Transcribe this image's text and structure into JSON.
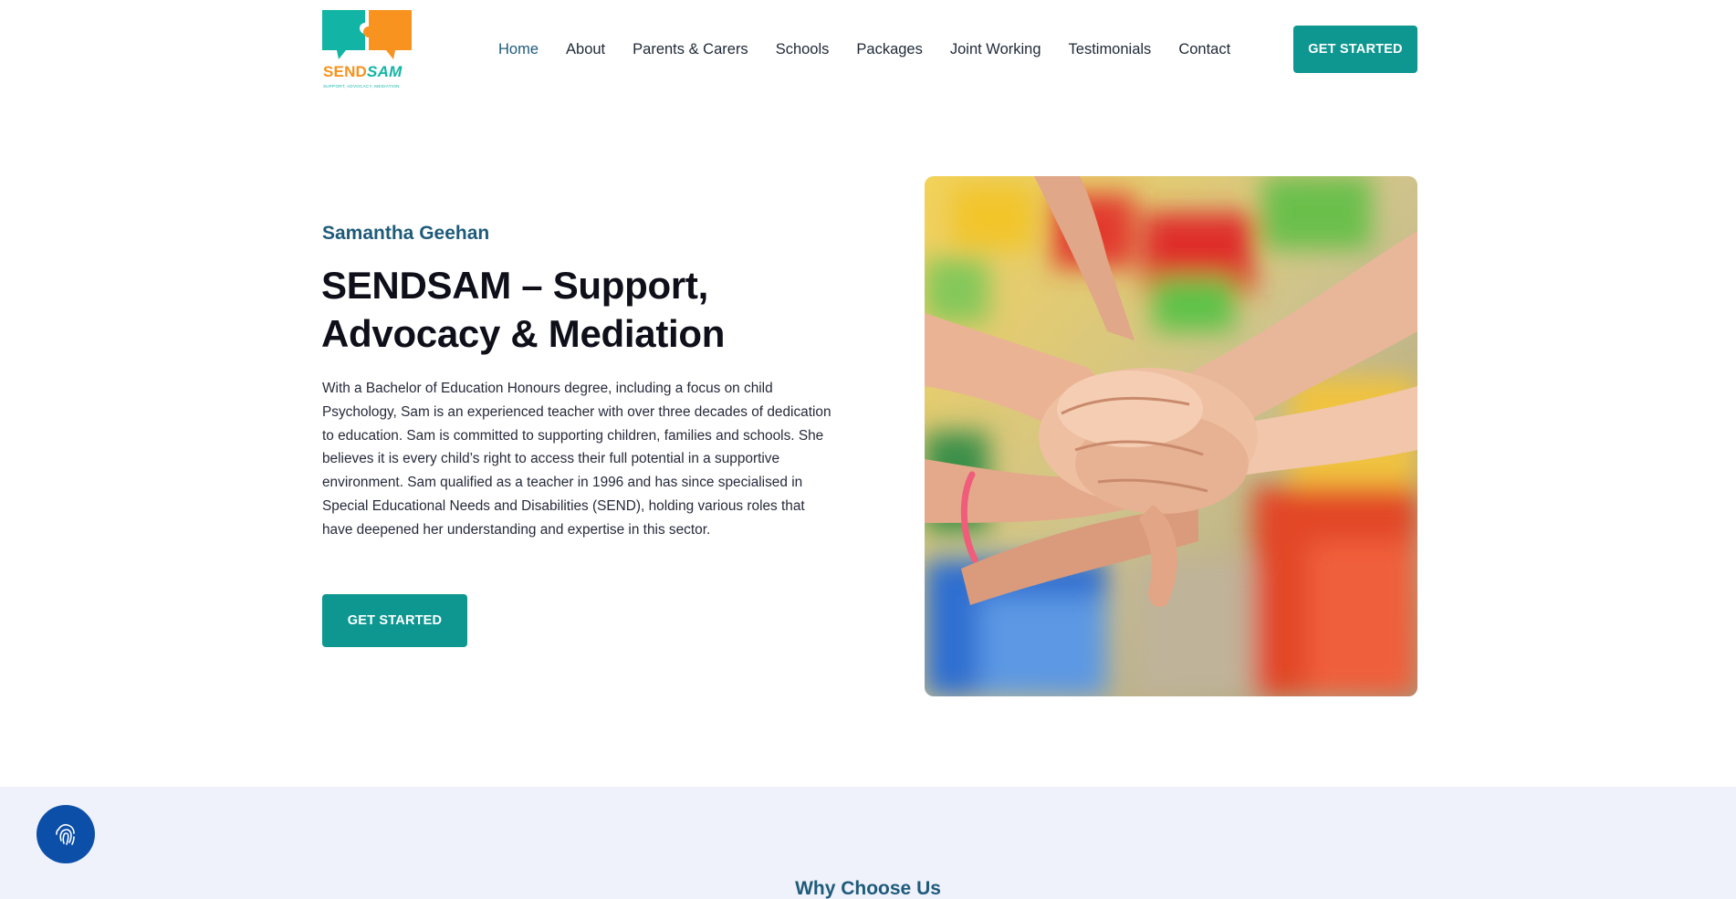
{
  "brand": {
    "word_part1": "SEND",
    "word_part2": "SAM",
    "tagline": "Support, Advocacy, Mediation",
    "colors": {
      "orange": "#f7931e",
      "teal": "#12b5a5"
    }
  },
  "nav": {
    "items": [
      {
        "label": "Home",
        "active": true
      },
      {
        "label": "About"
      },
      {
        "label": "Parents & Carers"
      },
      {
        "label": "Schools"
      },
      {
        "label": "Packages"
      },
      {
        "label": "Joint Working"
      },
      {
        "label": "Testimonials"
      },
      {
        "label": "Contact"
      }
    ],
    "cta_label": "GET STARTED"
  },
  "hero": {
    "eyebrow": "Samantha Geehan",
    "title": "SENDSAM – Support, Advocacy & Mediation",
    "body": "With a Bachelor of Education Honours degree, including a focus on child Psychology, Sam is an experienced teacher with over three decades of dedication to education. Sam is committed to supporting children, families and schools. She believes it is every child’s right to access their full potential in a supportive environment. Sam qualified as a teacher in 1996 and has since specialised in Special Educational Needs and Disabilities (SEND), holding various roles that have deepened her understanding and expertise in this sector.",
    "cta_label": "GET STARTED",
    "image_icon": "stacked-hands-photo"
  },
  "why": {
    "heading": "Why Choose Us"
  },
  "accessibility": {
    "icon": "fingerprint-icon"
  },
  "colors": {
    "accent": "#0e9790",
    "heading_blue": "#1e5b7a",
    "section_bg": "#eff1fb",
    "fab_bg": "#0b4fa8"
  }
}
